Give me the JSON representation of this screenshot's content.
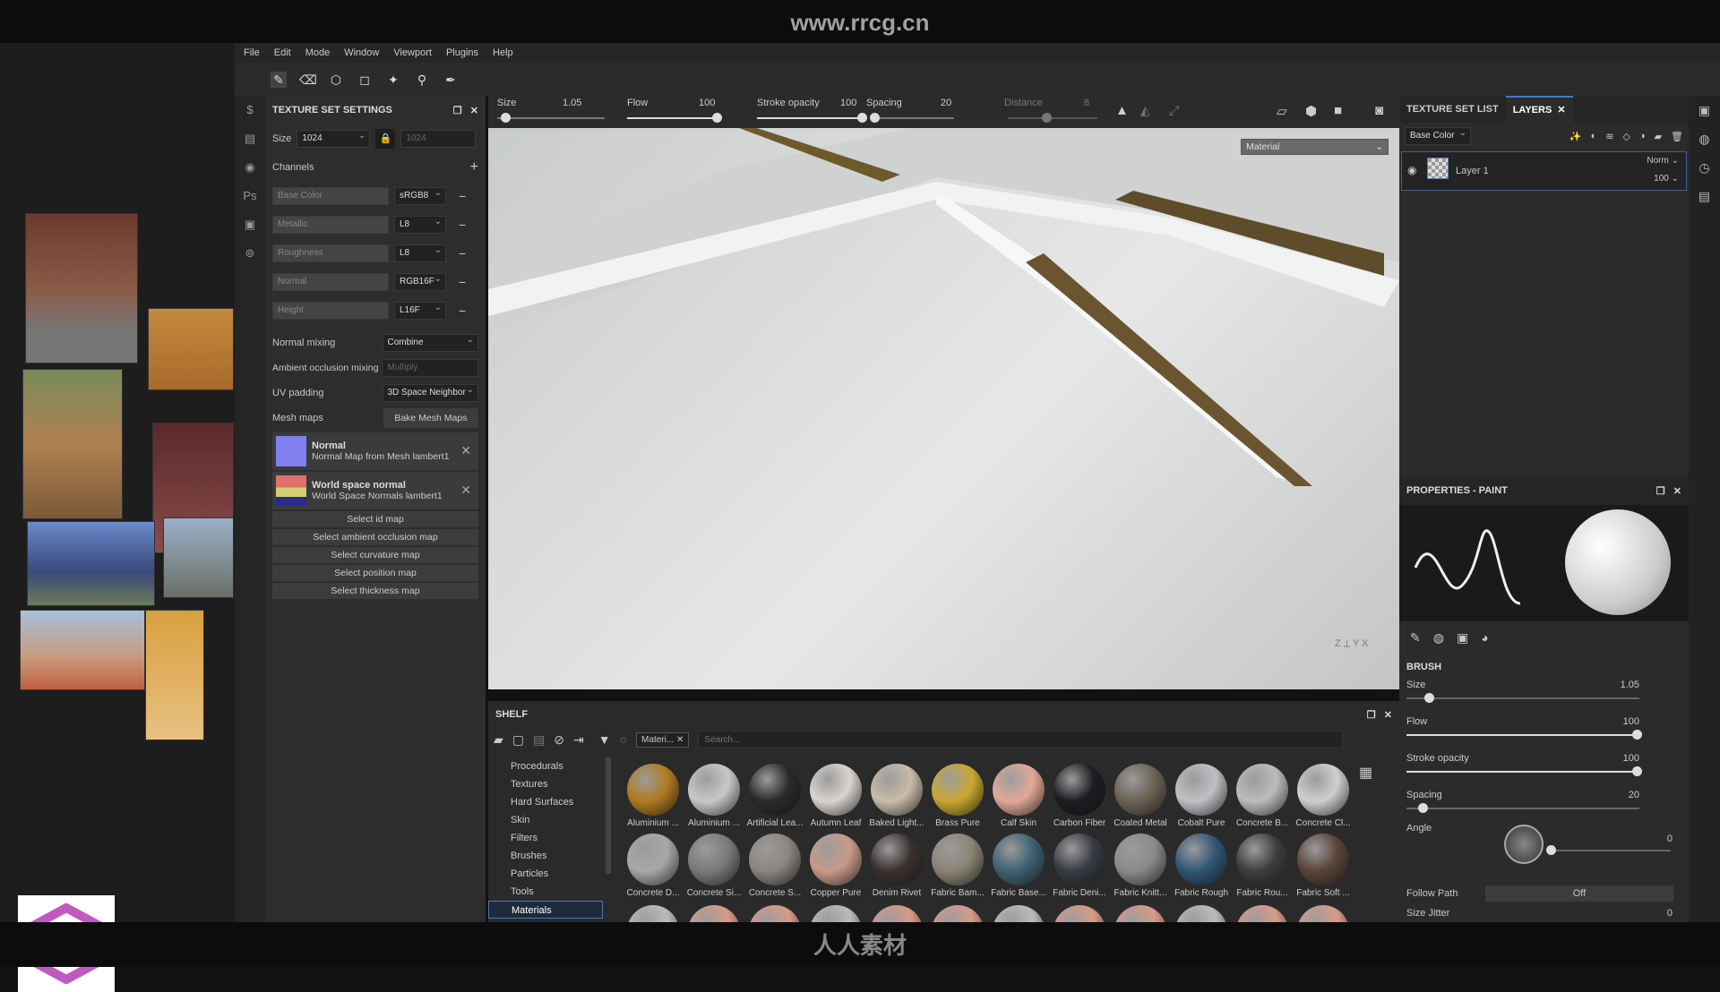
{
  "watermark": "www.rrcg.cn",
  "bottom_watermark": "人人素材",
  "menu": [
    "File",
    "Edit",
    "Mode",
    "Window",
    "Viewport",
    "Plugins",
    "Help"
  ],
  "texture_set_settings": {
    "title": "TEXTURE SET SETTINGS",
    "size_label": "Size",
    "size_value": "1024",
    "size_locked_value": "1024",
    "channels_label": "Channels",
    "channels": [
      {
        "name": "Base Color",
        "format": "sRGB8"
      },
      {
        "name": "Metallic",
        "format": "L8"
      },
      {
        "name": "Roughness",
        "format": "L8"
      },
      {
        "name": "Normal",
        "format": "RGB16F"
      },
      {
        "name": "Height",
        "format": "L16F"
      }
    ],
    "normal_mixing_label": "Normal mixing",
    "normal_mixing": "Combine",
    "ao_mixing_label": "Ambient occlusion mixing",
    "ao_mixing": "Multiply",
    "uv_padding_label": "UV padding",
    "uv_padding": "3D Space Neighbor",
    "mesh_maps_label": "Mesh maps",
    "bake_button": "Bake Mesh Maps",
    "maps": [
      {
        "title": "Normal",
        "subtitle": "Normal Map from Mesh lambert1"
      },
      {
        "title": "World space normal",
        "subtitle": "World Space Normals lambert1"
      }
    ],
    "select_buttons": [
      "Select id map",
      "Select ambient occlusion map",
      "Select curvature map",
      "Select position map",
      "Select thickness map"
    ]
  },
  "brush_bar": {
    "size_label": "Size",
    "size": "1.05",
    "flow_label": "Flow",
    "flow": "100",
    "opacity_label": "Stroke opacity",
    "opacity": "100",
    "spacing_label": "Spacing",
    "spacing": "20",
    "distance_label": "Distance",
    "distance": "8"
  },
  "viewport": {
    "mode": "Material"
  },
  "shelf": {
    "title": "SHELF",
    "filter_tag": "Materi...",
    "search_placeholder": "Search...",
    "categories": [
      "Procedurals",
      "Textures",
      "Hard Surfaces",
      "Skin",
      "Filters",
      "Brushes",
      "Particles",
      "Tools",
      "Materials"
    ],
    "selected_category": "Materials",
    "materials": [
      {
        "name": "Aluminium ...",
        "color": "#b07a20"
      },
      {
        "name": "Aluminium ...",
        "color": "#c8c8c8"
      },
      {
        "name": "Artificial Lea...",
        "color": "#2a2a2c"
      },
      {
        "name": "Autumn Leaf",
        "color": "#d8d4d0"
      },
      {
        "name": "Baked Light...",
        "color": "#c9bba8"
      },
      {
        "name": "Brass Pure",
        "color": "#c9a830"
      },
      {
        "name": "Calf Skin",
        "color": "#e2a896"
      },
      {
        "name": "Carbon Fiber",
        "color": "#1c1d20"
      },
      {
        "name": "Coated Metal",
        "color": "#6b6254"
      },
      {
        "name": "Cobalt Pure",
        "color": "#c0c0c4"
      },
      {
        "name": "Concrete B...",
        "color": "#bcbcbc"
      },
      {
        "name": "Concrete Cl...",
        "color": "#cfcfcf"
      },
      {
        "name": "Concrete D...",
        "color": "#a8a8a8"
      },
      {
        "name": "Concrete Si...",
        "color": "#7a7a7a"
      },
      {
        "name": "Concrete S...",
        "color": "#8a8580"
      },
      {
        "name": "Copper Pure",
        "color": "#c89a88"
      },
      {
        "name": "Denim Rivet",
        "color": "#3a3230"
      },
      {
        "name": "Fabric Bam...",
        "color": "#8a8474"
      },
      {
        "name": "Fabric Base...",
        "color": "#3f6074"
      },
      {
        "name": "Fabric Deni...",
        "color": "#383b42"
      },
      {
        "name": "Fabric Knitt...",
        "color": "#8a8a8c"
      },
      {
        "name": "Fabric Rough",
        "color": "#2f5676"
      },
      {
        "name": "Fabric Rou...",
        "color": "#3e3e40"
      },
      {
        "name": "Fabric Soft ...",
        "color": "#5a4438"
      }
    ]
  },
  "layers": {
    "tab_inactive": "TEXTURE SET LIST",
    "tab_active": "LAYERS",
    "channel": "Base Color",
    "layer_name": "Layer 1",
    "blend": "Norm",
    "opacity": "100"
  },
  "properties": {
    "title": "PROPERTIES - PAINT",
    "section": "BRUSH",
    "sliders": [
      {
        "label": "Size",
        "value": "1.05",
        "fraction": 0.08
      },
      {
        "label": "Flow",
        "value": "100",
        "fraction": 1
      },
      {
        "label": "Stroke opacity",
        "value": "100",
        "fraction": 1
      },
      {
        "label": "Spacing",
        "value": "20",
        "fraction": 0.05
      }
    ],
    "angle_label": "Angle",
    "angle": "0",
    "follow_path_label": "Follow Path",
    "follow_path": "Off",
    "size_jitter_label": "Size Jitter",
    "size_jitter": "0"
  }
}
